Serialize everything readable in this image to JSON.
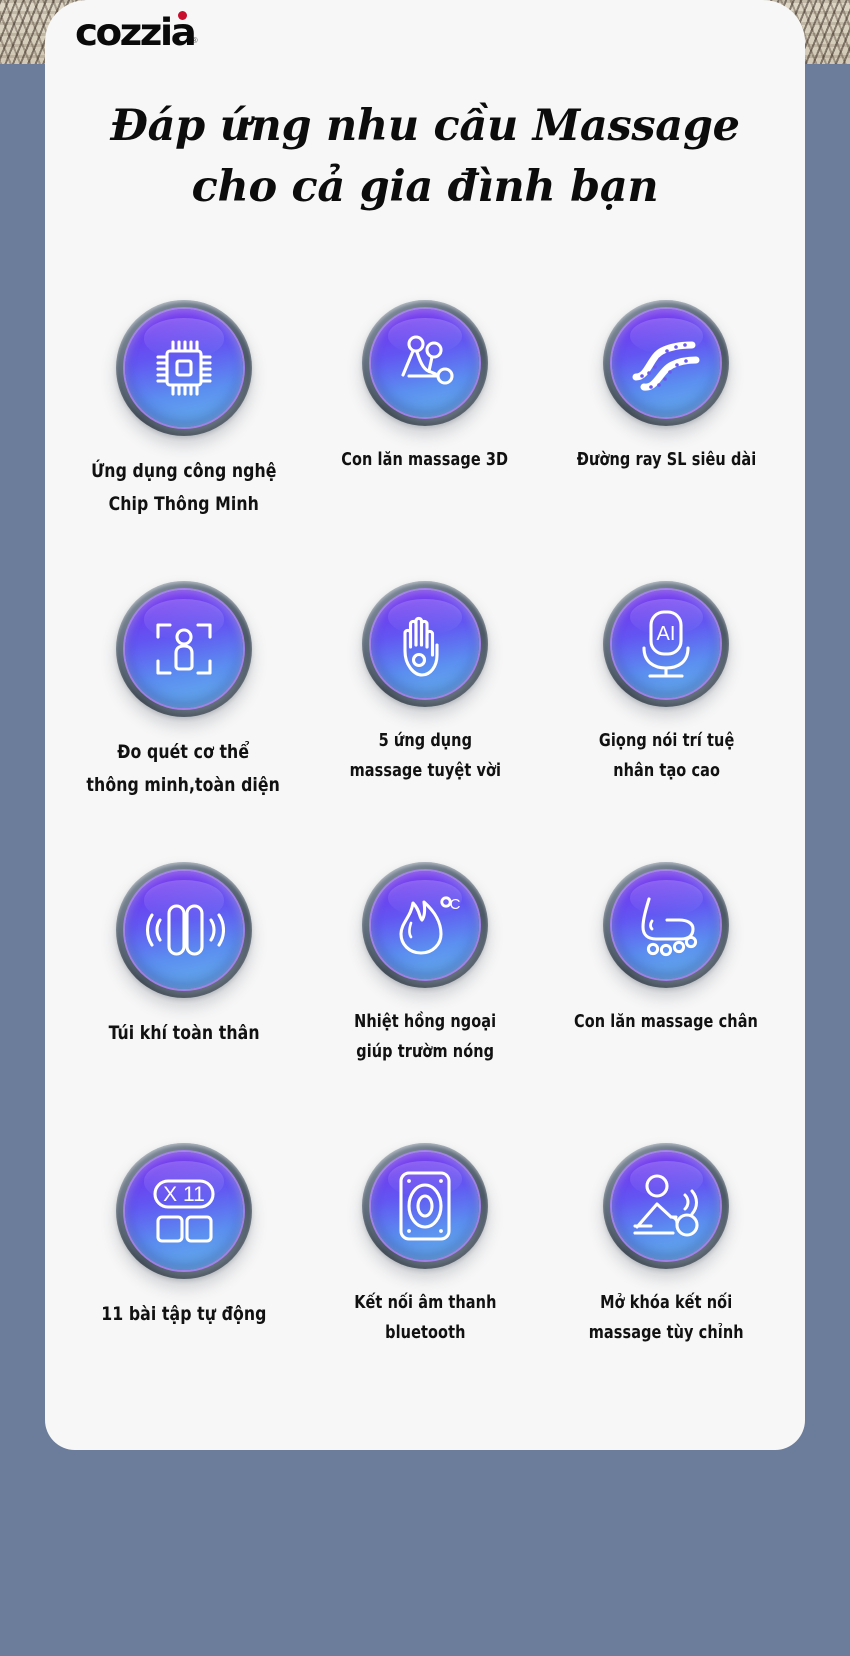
{
  "page": {
    "background_color": "#6c7d9b",
    "card_color": "#f7f7f7"
  },
  "brand": {
    "name": "cozzia",
    "trademark": "®",
    "dot_color": "#c8102e"
  },
  "heading": {
    "line1": "Đáp ứng nhu cầu Massage",
    "line2": "cho cả gia đình bạn"
  },
  "features": [
    {
      "icon": "chip-icon",
      "label_lines": [
        "Ứng dụng công nghệ",
        "Chip Thông Minh"
      ],
      "size": "big"
    },
    {
      "icon": "roller-3d-icon",
      "label_lines": [
        "Con lăn massage 3D"
      ],
      "size": "small"
    },
    {
      "icon": "sl-track-icon",
      "label_lines": [
        "Đường ray SL siêu dài"
      ],
      "size": "small"
    },
    {
      "icon": "body-scan-icon",
      "label_lines": [
        "Đo quét cơ thể",
        "thông minh,toàn diện"
      ],
      "size": "big"
    },
    {
      "icon": "hand-icon",
      "label_lines": [
        "5 ứng dụng",
        "massage tuyệt vời"
      ],
      "size": "small"
    },
    {
      "icon": "ai-microphone-icon",
      "label_lines": [
        "Giọng nói trí tuệ",
        "nhân tạo cao"
      ],
      "size": "small"
    },
    {
      "icon": "airbag-icon",
      "label_lines": [
        "Túi khí toàn thân"
      ],
      "size": "big"
    },
    {
      "icon": "heat-flame-icon",
      "label_lines": [
        "Nhiệt hồng ngoại",
        "giúp trườm nóng"
      ],
      "size": "small"
    },
    {
      "icon": "foot-roller-icon",
      "label_lines": [
        "Con lăn massage chân"
      ],
      "size": "small"
    },
    {
      "icon": "programs-x11-icon",
      "label_lines": [
        "11 bài tập tự động"
      ],
      "size": "big"
    },
    {
      "icon": "bluetooth-speaker-icon",
      "label_lines": [
        "Kết nối âm thanh",
        "bluetooth"
      ],
      "size": "small"
    },
    {
      "icon": "custom-massage-icon",
      "label_lines": [
        "Mở khóa kết nối",
        "massage tùy chỉnh"
      ],
      "size": "small"
    }
  ],
  "icon_badge": {
    "ring_color": "#5e6b7a",
    "face_gradient_start": "#7b2fe8",
    "face_gradient_end": "#67b7ec",
    "glyph_color": "#ffffff"
  }
}
